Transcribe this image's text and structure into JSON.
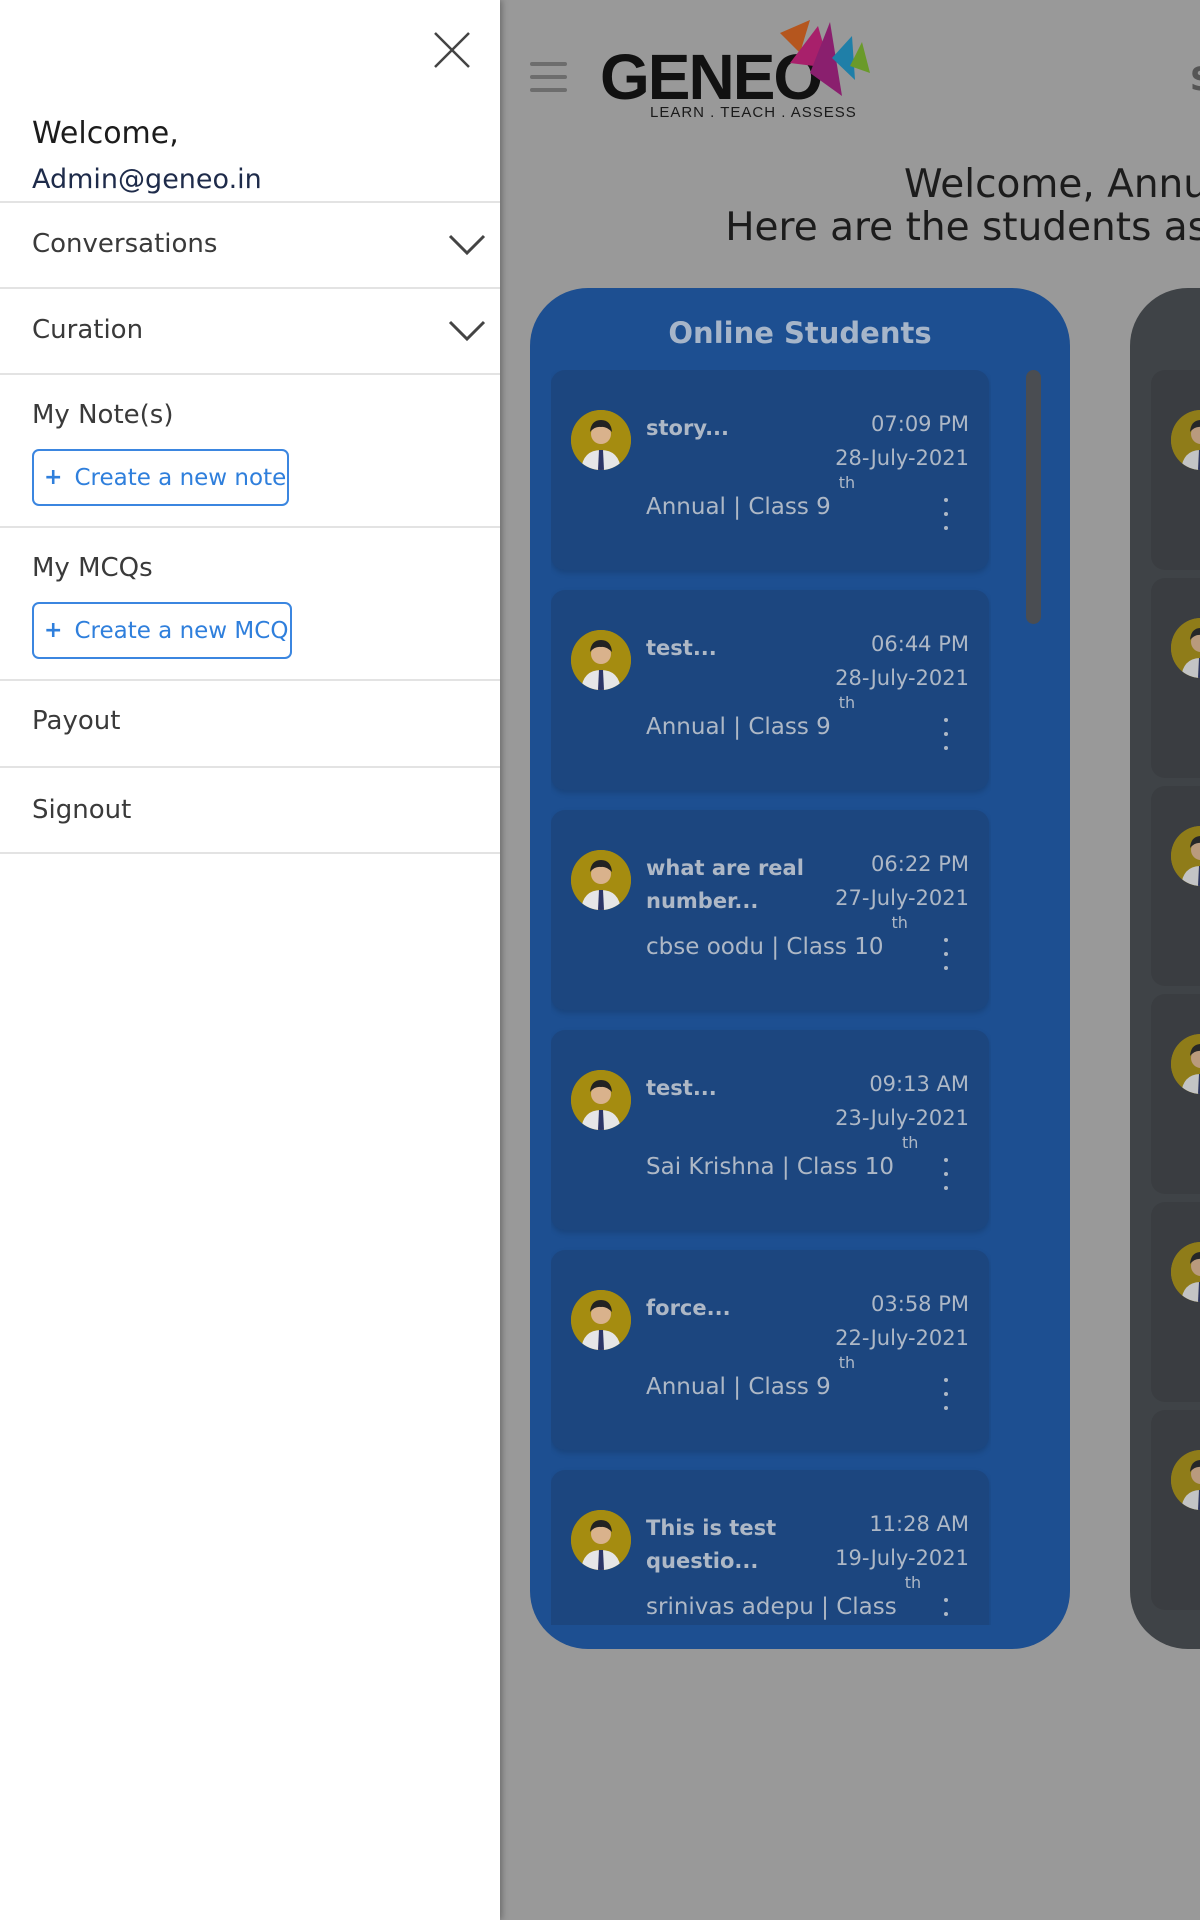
{
  "drawer": {
    "welcome": "Welcome,",
    "email": "Admin@geneo.in",
    "conversations": "Conversations",
    "curation": "Curation",
    "notes": "My Note(s)",
    "create_note": "Create a new note",
    "mcqs": "My MCQs",
    "create_mcq": "Create a new MCQ",
    "payout": "Payout",
    "signout": "Signout",
    "plus": "+"
  },
  "header": {
    "logo_word": "GENEO",
    "logo_tagline": "LEARN . TEACH . ASSESS",
    "top_right_partial": "S",
    "welcome_line1": "Welcome, Annu",
    "welcome_line2": "Here are the students as"
  },
  "online_students": {
    "title": "Online Students",
    "items": [
      {
        "title": "story...",
        "time": "07:09 PM",
        "date": "28-July-2021",
        "subtitle": "Annual | Class 9",
        "suffix": "th"
      },
      {
        "title": "test...",
        "time": "06:44 PM",
        "date": "28-July-2021",
        "subtitle": "Annual | Class 9",
        "suffix": "th"
      },
      {
        "title": "what are real number...",
        "time": "06:22 PM",
        "date": "27-July-2021",
        "subtitle": "cbse oodu | Class 10",
        "suffix": "th"
      },
      {
        "title": "test...",
        "time": "09:13 AM",
        "date": "23-July-2021",
        "subtitle": "Sai Krishna | Class 10",
        "suffix": "th"
      },
      {
        "title": "force...",
        "time": "03:58 PM",
        "date": "22-July-2021",
        "subtitle": "Annual | Class 9",
        "suffix": "th"
      },
      {
        "title": "This is test questio...",
        "time": "11:28 AM",
        "date": "19-July-2021",
        "subtitle": "srinivas adepu | Class",
        "suffix": "th"
      }
    ]
  },
  "colors": {
    "accent": "#2f7fdc",
    "card": "#1d4f91",
    "overlay": "#999999"
  },
  "icons": {
    "close": "close-icon",
    "chevron": "chevron-down-icon",
    "menu": "hamburger-menu-icon",
    "more": "kebab-menu-icon",
    "avatar": "student-avatar-icon"
  }
}
